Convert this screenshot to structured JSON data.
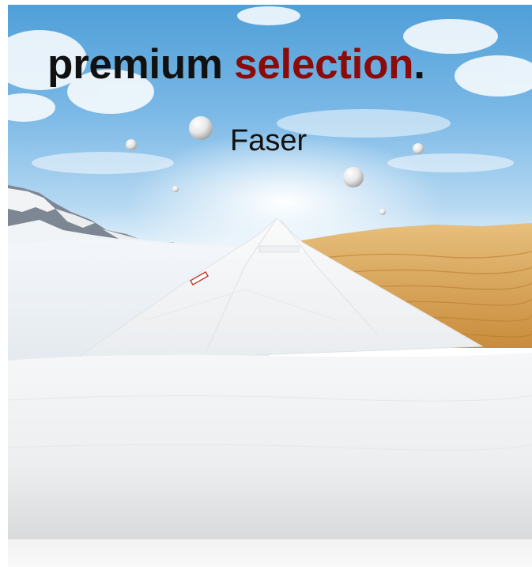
{
  "headline": {
    "part1": "premium",
    "part2": "selection",
    "part3": "."
  },
  "subline": "Faser",
  "colors": {
    "headline_text": "#111111",
    "accent": "#8b0a0a",
    "sky": "#5aa6de",
    "sand": "#d9a356"
  },
  "scene": {
    "left_scenery": "snowy-mountains",
    "right_scenery": "desert-dunes",
    "center_object": "white-duvet",
    "floating_objects": "white-spheres"
  }
}
